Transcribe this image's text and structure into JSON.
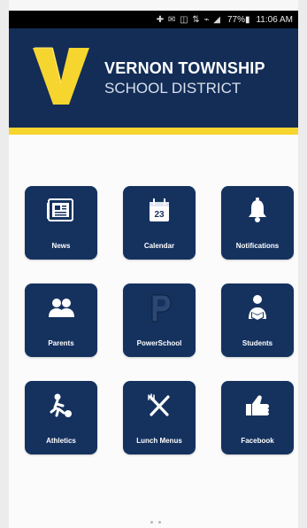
{
  "status_bar": {
    "icons": "✚ ✉ ◫ ⇅ ⌁ ◢",
    "battery": "77%▮",
    "time": "11:06 AM"
  },
  "header": {
    "logo_letter": "V",
    "title_main": "VERNON TOWNSHIP",
    "title_sub": "SCHOOL DISTRICT"
  },
  "calendar": {
    "day": "23"
  },
  "tiles": [
    {
      "label": "News",
      "icon": "newspaper-icon"
    },
    {
      "label": "Calendar",
      "icon": "calendar-icon"
    },
    {
      "label": "Notifications",
      "icon": "bell-icon"
    },
    {
      "label": "Parents",
      "icon": "parents-icon"
    },
    {
      "label": "PowerSchool",
      "icon": "powerschool-icon"
    },
    {
      "label": "Students",
      "icon": "student-icon"
    },
    {
      "label": "Athletics",
      "icon": "athletics-icon"
    },
    {
      "label": "Lunch Menus",
      "icon": "fork-knife-icon"
    },
    {
      "label": "Facebook",
      "icon": "thumbs-up-icon"
    }
  ],
  "colors": {
    "navy": "#132d57",
    "tile": "#15325f",
    "gold": "#f6d52f",
    "white": "#ffffff"
  }
}
